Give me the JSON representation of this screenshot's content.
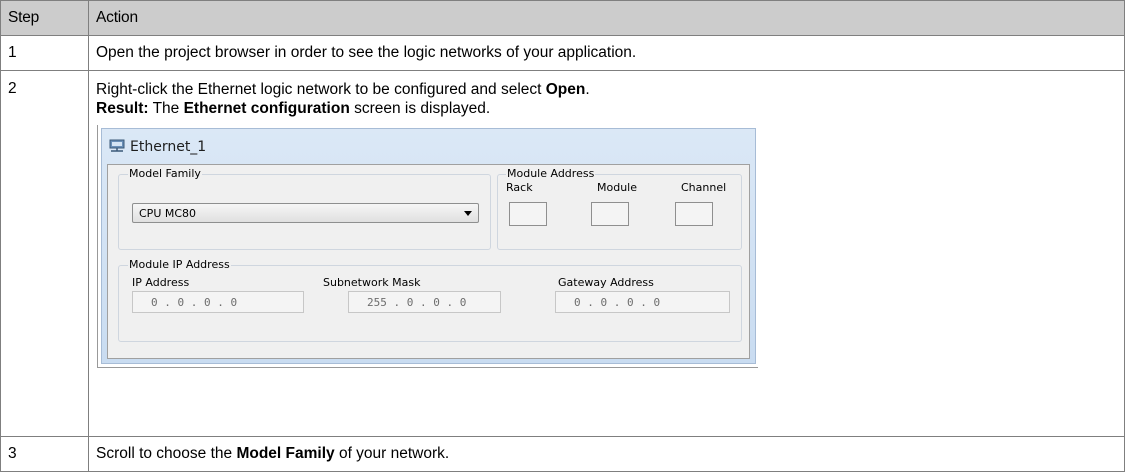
{
  "table": {
    "headers": {
      "step": "Step",
      "action": "Action"
    },
    "rows": [
      {
        "step": "1",
        "text": "Open the project browser in order to see the logic networks of your application."
      },
      {
        "step": "2",
        "line1_before": "Right-click the Ethernet logic network to be configured and select ",
        "line1_bold": "Open",
        "line1_after": ".",
        "line2_bold_result": "Result:",
        "line2_mid": " The ",
        "line2_bold": "Ethernet configuration",
        "line2_after": " screen is displayed."
      },
      {
        "step": "3",
        "before": "Scroll to choose the ",
        "bold": "Model Family",
        "after": " of your network."
      }
    ]
  },
  "screenshot": {
    "window_title": "Ethernet_1",
    "window_icon": "network-icon",
    "model_family": {
      "label": "Model Family",
      "selected": "CPU MC80"
    },
    "module_address": {
      "label": "Module Address",
      "rack": "Rack",
      "module": "Module",
      "channel": "Channel"
    },
    "module_ip": {
      "label": "Module IP Address",
      "ip_label": "IP Address",
      "ip_value": "0 . 0 . 0 . 0",
      "mask_label": "Subnetwork Mask",
      "mask_value": "255 . 0 . 0 . 0",
      "gateway_label": "Gateway Address",
      "gateway_value": "0 . 0 . 0 . 0"
    }
  }
}
